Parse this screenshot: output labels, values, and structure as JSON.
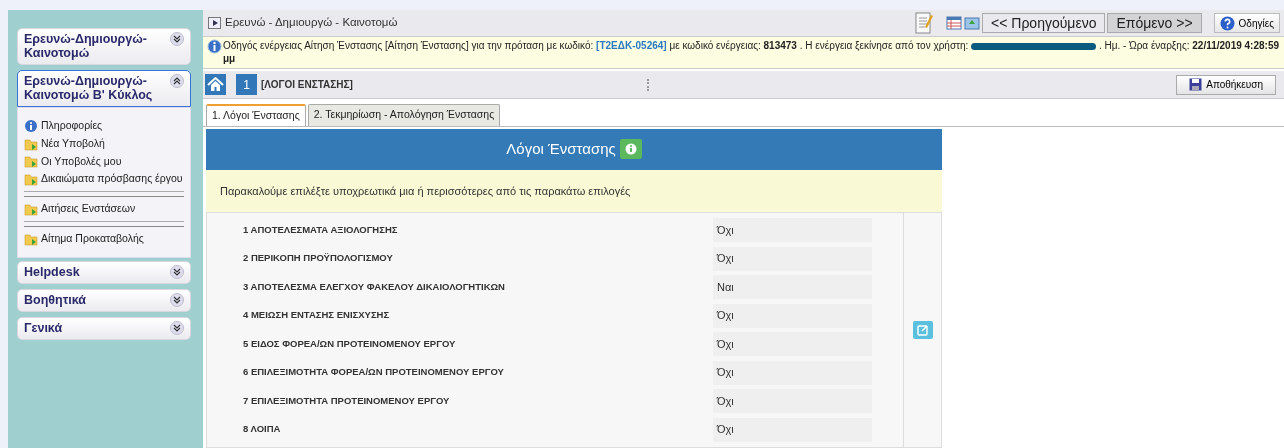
{
  "sidebar": {
    "sections": [
      {
        "title": "Ερευνώ-Δημιουργώ-Καινοτομώ",
        "expanded": false
      },
      {
        "title": "Ερευνώ-Δημιουργώ-Καινοτομώ Β' Κύκλος",
        "expanded": true,
        "groups": [
          [
            {
              "label": "Πληροφορίες",
              "kind": "info"
            },
            {
              "label": "Νέα Υποβολή",
              "kind": "folder"
            },
            {
              "label": "Οι Υποβολές μου",
              "kind": "folder"
            },
            {
              "label": "Δικαιώματα πρόσβασης έργου",
              "kind": "folder"
            }
          ],
          [
            {
              "label": "Αιτήσεις Ενστάσεων",
              "kind": "folder"
            }
          ],
          [
            {
              "label": "Αίτημα Προκαταβολής",
              "kind": "folder"
            }
          ]
        ]
      },
      {
        "title": "Helpdesk",
        "expanded": false
      },
      {
        "title": "Βοηθητικά",
        "expanded": false
      },
      {
        "title": "Γενικά",
        "expanded": false
      }
    ]
  },
  "window": {
    "title": "Ερευνώ - Δημιουργώ - Καινοτομώ"
  },
  "nav_buttons": [
    {
      "label": "<< Προηγούμενο",
      "highlighted": false
    },
    {
      "label": "Επόμενο >>",
      "highlighted": true
    }
  ],
  "help_button": "Οδηγίες",
  "info_bar": {
    "text_1": "Οδηγός ενέργειας Αίτηση Ένστασης [Αίτηση Ένστασης] για την πρόταση με κωδικό:",
    "code": "[Τ2ΕΔΚ-05264]",
    "text_2": "με κωδικό ενέργειας: **813473** . Η ενέργεια ξεκίνησε από τον χρήστη:",
    "text_3": ". Ημ. - Ώρα έναρξης: **22/11/2019 4:28:59 μμ**"
  },
  "toolbar": {
    "step": "1",
    "step_title": "[ΛΟΓΟΙ ΕΝΣΤΑΣΗΣ]",
    "save_button": "Αποθήκευση"
  },
  "tabs": [
    {
      "label": "1. Λόγοι Ένστασης",
      "selected": true
    },
    {
      "label": "2. Τεκμηρίωση - Απολόγηση Ένστασης",
      "selected": false
    }
  ],
  "form": {
    "title": "Λόγοι Ένστασης",
    "notice": "Παρακαλούμε επιλέξτε υποχρεωτικά μια ή περισσότερες από τις παρακάτω επιλογές",
    "reasons": [
      {
        "label": "1 ΑΠΟΤΕΛΕΣΜΑΤΑ ΑΞΙΟΛΟΓΗΣΗΣ",
        "value": "Όχι"
      },
      {
        "label": "2 ΠΕΡΙΚΟΠΗ ΠΡΟΫΠΟΛΟΓΙΣΜΟΥ",
        "value": "Όχι"
      },
      {
        "label": "3 ΑΠΟΤΕΛΕΣΜΑ ΕΛΕΓΧΟΥ ΦΑΚΕΛΟΥ ΔΙΚΑΙΟΛΟΓΗΤΙΚΩΝ",
        "value": "Ναι"
      },
      {
        "label": "4 ΜΕΙΩΣΗ ΕΝΤΑΣΗΣ ΕΝΙΣΧΥΣΗΣ",
        "value": "Όχι"
      },
      {
        "label": "5 ΕΙΔΟΣ ΦΟΡΕΑ/ΩΝ ΠΡΟΤΕΙΝΟΜΕΝΟΥ ΕΡΓΟΥ",
        "value": "Όχι"
      },
      {
        "label": "6 ΕΠΙΛΕΞΙΜΟΤΗΤΑ ΦΟΡΕΑ/ΩΝ ΠΡΟΤΕΙΝΟΜΕΝΟΥ ΕΡΓΟΥ",
        "value": "Όχι"
      },
      {
        "label": "7 ΕΠΙΛΕΞΙΜΟΤΗΤΑ ΠΡΟΤΕΙΝΟΜΕΝΟΥ ΕΡΓΟΥ",
        "value": "Όχι"
      },
      {
        "label": "8 ΛΟΙΠΑ",
        "value": "Όχι"
      }
    ]
  }
}
